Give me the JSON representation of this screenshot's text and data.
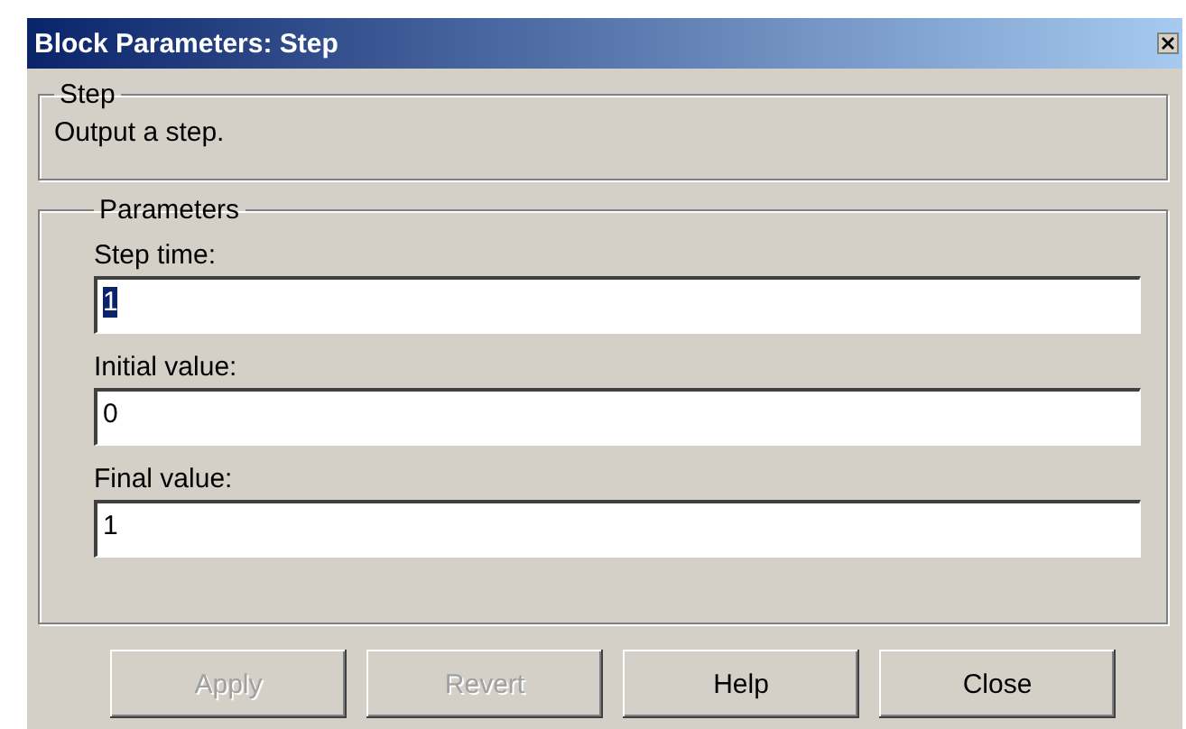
{
  "window": {
    "title": "Block Parameters: Step"
  },
  "description_group": {
    "title": "Step",
    "text": "Output a step."
  },
  "parameters_group": {
    "title": "Parameters",
    "fields": [
      {
        "label": "Step time:",
        "value": "1",
        "selected": true
      },
      {
        "label": "Initial value:",
        "value": "0",
        "selected": false
      },
      {
        "label": "Final value:",
        "value": "1",
        "selected": false
      }
    ]
  },
  "buttons": [
    {
      "label": "Apply",
      "disabled": true
    },
    {
      "label": "Revert",
      "disabled": true
    },
    {
      "label": "Help",
      "disabled": false
    },
    {
      "label": "Close",
      "disabled": false
    }
  ]
}
